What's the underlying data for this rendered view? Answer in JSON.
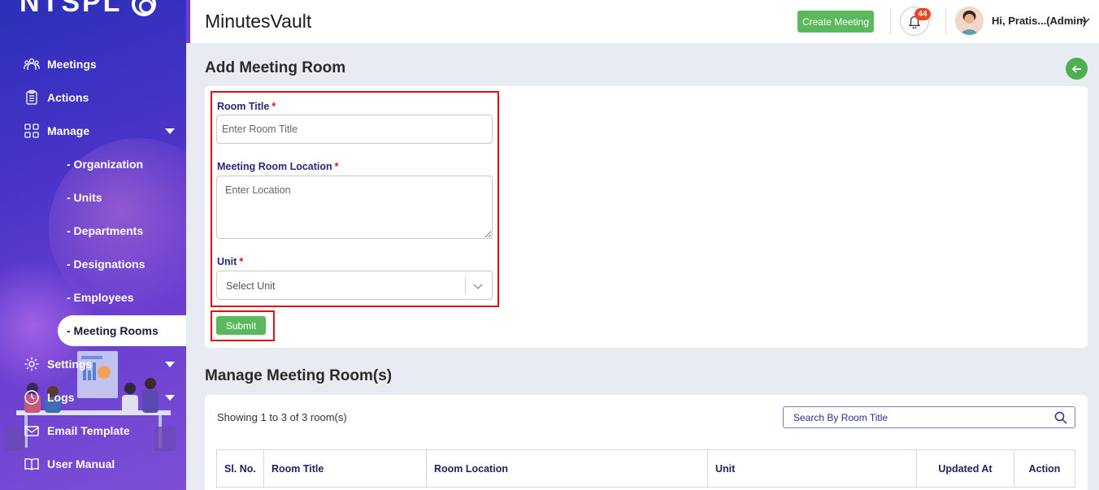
{
  "app": {
    "logo_text": "NTSPL",
    "title": "MinutesVault"
  },
  "header": {
    "create_meeting_label": "Create Meeting",
    "notification_count": "44",
    "user_greeting": "Hi, Pratis...(Admin)"
  },
  "sidebar": {
    "items": [
      {
        "label": "Meetings",
        "icon": "meetings-icon"
      },
      {
        "label": "Actions",
        "icon": "clipboard-icon"
      },
      {
        "label": "Manage",
        "icon": "grid-icon"
      },
      {
        "label": "Settings",
        "icon": "gear-icon"
      },
      {
        "label": "Logs",
        "icon": "clock-icon"
      },
      {
        "label": "Email Template",
        "icon": "envelope-icon"
      },
      {
        "label": "User Manual",
        "icon": "book-icon"
      }
    ],
    "manage_sub": [
      "- Organization",
      "- Units",
      "- Departments",
      "- Designations",
      "- Employees",
      "- Meeting Rooms"
    ]
  },
  "form": {
    "section_title": "Add Meeting Room",
    "room_title_label": "Room Title",
    "room_title_placeholder": "Enter Room Title",
    "location_label": "Meeting Room Location",
    "location_placeholder": "Enter Location",
    "unit_label": "Unit",
    "unit_placeholder": "Select Unit",
    "required_mark": "*",
    "submit_label": "Submit"
  },
  "manage": {
    "section_title": "Manage Meeting Room(s)",
    "showing_text": "Showing 1 to 3 of 3 room(s)",
    "search_placeholder": "Search By Room Title",
    "columns": [
      "Sl. No.",
      "Room Title",
      "Room Location",
      "Unit",
      "Updated At",
      "Action"
    ]
  },
  "colors": {
    "primary_green": "#5cb85c",
    "sidebar_blue": "#2a2fb8",
    "highlight_red": "#e01010",
    "label_navy": "#242a7a"
  }
}
